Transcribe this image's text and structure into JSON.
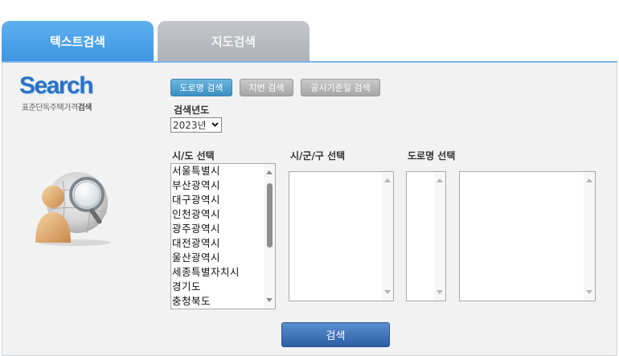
{
  "tabs": [
    {
      "label": "텍스트검색",
      "active": true
    },
    {
      "label": "지도검색",
      "active": false
    }
  ],
  "logo": {
    "title": "Search",
    "subtitle_normal": "표준단독주택가격",
    "subtitle_bold": "검색"
  },
  "mode_buttons": [
    {
      "label": "도로명 검색",
      "active": true
    },
    {
      "label": "지번 검색",
      "active": false
    },
    {
      "label": "공시기준일 검색",
      "active": false
    }
  ],
  "year": {
    "label": "검색년도",
    "value": "2023년"
  },
  "sido": {
    "label": "시/도 선택",
    "items": [
      "서울특별시",
      "부산광역시",
      "대구광역시",
      "인천광역시",
      "광주광역시",
      "대전광역시",
      "울산광역시",
      "세종특별자치시",
      "경기도",
      "충청북도"
    ]
  },
  "sigungu": {
    "label": "시/군/구 선택"
  },
  "road": {
    "label": "도로명 선택"
  },
  "search_button": {
    "label": "검색"
  },
  "colors": {
    "active_tab": "#4fa3ea",
    "inactive_tab": "#b8babf",
    "active_mode": "#4a9fcf",
    "search_button": "#3a6fb8"
  }
}
